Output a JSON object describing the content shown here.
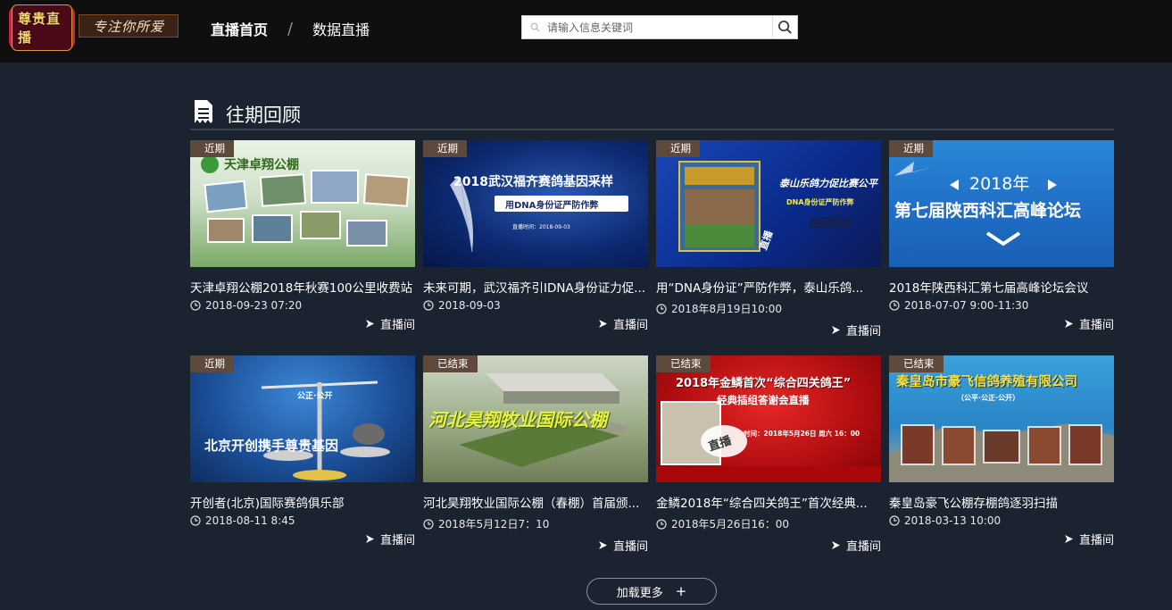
{
  "header": {
    "logo_text": "尊贵直播",
    "slogan": "专注你所爱",
    "nav": [
      {
        "label": "直播首页",
        "active": true
      },
      {
        "label": "数据直播",
        "active": false
      }
    ],
    "nav_separator": "/",
    "search": {
      "placeholder": "请输入信息关键词"
    }
  },
  "section": {
    "title": "往期回顾",
    "icon": "document-icon"
  },
  "live_label": "直播间",
  "cards": [
    {
      "badge": "近期",
      "title": "天津卓翔公棚2018年秋赛100公里收费站",
      "date": "2018-09-23 07:20",
      "thumb_text": "天津卓翔公棚"
    },
    {
      "badge": "近期",
      "title": "未来可期，武汉福齐引IDNA身份证力促...",
      "date": "2018-09-03",
      "thumb_text": "2018武汉福齐赛鸽基因采样",
      "thumb_sub": "用DNA身份证严防作弊",
      "thumb_small": "直播时间：2018-09-03"
    },
    {
      "badge": "近期",
      "title": "用“DNA身份证”严防作弊，泰山乐鸽...",
      "date": "2018年8月19日10:00",
      "thumb_text": "泰山乐鸽力促比赛公平",
      "thumb_sub": "DNA身份证严防作弊",
      "thumb_small": "直播"
    },
    {
      "badge": "近期",
      "title": "2018年陕西科汇第七届高峰论坛会议",
      "date": "2018-07-07 9:00-11:30",
      "thumb_text": "2018年",
      "thumb_sub": "第七届陕西科汇高峰论坛"
    },
    {
      "badge": "近期",
      "title": "开创者(北京)国际赛鸽俱乐部",
      "date": "2018-08-11 8:45",
      "thumb_text": "北京开创携手尊贵基因",
      "thumb_sub": "公正·公开"
    },
    {
      "badge": "已结束",
      "title": "河北昊翔牧业国际公棚（春棚）首届颁...",
      "date": "2018年5月12日7：10",
      "thumb_text": "河北昊翔牧业国际公棚"
    },
    {
      "badge": "已结束",
      "title": "金鳞2018年“综合四关鸽王”首次经典...",
      "date": "2018年5月26日16：00",
      "thumb_text": "2018年金鳞首次“综合四关鸽王”",
      "thumb_sub": "经典插组答谢会直播",
      "thumb_small": "时间：2018年5月26日 周六 16：00",
      "thumb_tag": "直播"
    },
    {
      "badge": "已结束",
      "title": "秦皇岛豪飞公棚存棚鸽逐羽扫描",
      "date": "2018-03-13 10:00",
      "thumb_text": "秦皇岛市豪飞信鸽养殖有限公司",
      "thumb_sub": "（公平·公正·公开）"
    }
  ],
  "load_more": {
    "label": "加载更多",
    "plus": "+"
  },
  "colors": {
    "background": "#1b2230",
    "topbar": "#0f0f10",
    "badge": "#5e4a3c",
    "logo_red": "#8a0e28"
  }
}
